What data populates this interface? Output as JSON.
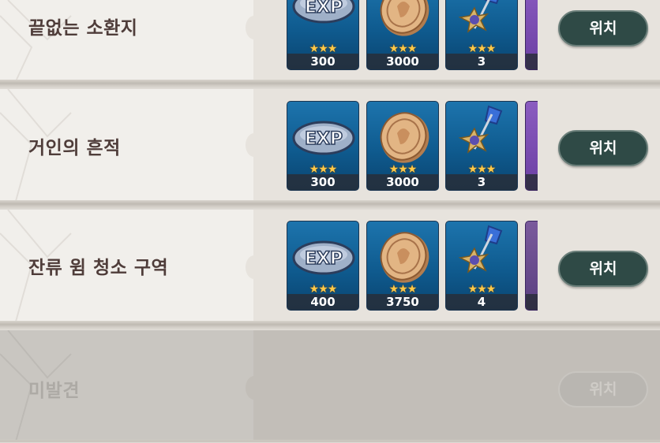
{
  "locations": [
    {
      "name": "끝없는 소환지",
      "rewards": [
        {
          "item": "exp-item",
          "stars": "★★★",
          "quantity": "300"
        },
        {
          "item": "coin-item",
          "stars": "★★★",
          "quantity": "3000"
        },
        {
          "item": "weapon-material-item",
          "stars": "★★★",
          "quantity": "3"
        },
        {
          "item": "purple-item",
          "stars": "",
          "quantity": ""
        }
      ],
      "button": "위치",
      "locked": false
    },
    {
      "name": "거인의 흔적",
      "rewards": [
        {
          "item": "exp-item",
          "stars": "★★★",
          "quantity": "300"
        },
        {
          "item": "coin-item",
          "stars": "★★★",
          "quantity": "3000"
        },
        {
          "item": "weapon-material-item",
          "stars": "★★★",
          "quantity": "3"
        },
        {
          "item": "purple-item",
          "stars": "",
          "quantity": ""
        }
      ],
      "button": "위치",
      "locked": false
    },
    {
      "name": "잔류 윔 청소 구역",
      "rewards": [
        {
          "item": "exp-item",
          "stars": "★★★",
          "quantity": "400"
        },
        {
          "item": "coin-item",
          "stars": "★★★",
          "quantity": "3750"
        },
        {
          "item": "weapon-material-item",
          "stars": "★★★",
          "quantity": "4"
        },
        {
          "item": "purple-item",
          "stars": "",
          "quantity": ""
        }
      ],
      "button": "위치",
      "locked": false
    },
    {
      "name": "미발견",
      "rewards": [],
      "button": "위치",
      "locked": true
    }
  ],
  "exp_label": "EXP",
  "colors": {
    "button": "#2f4a46",
    "title": "#4f3d3a",
    "card_blue": "#1d74ad",
    "star": "#ffc94a"
  }
}
